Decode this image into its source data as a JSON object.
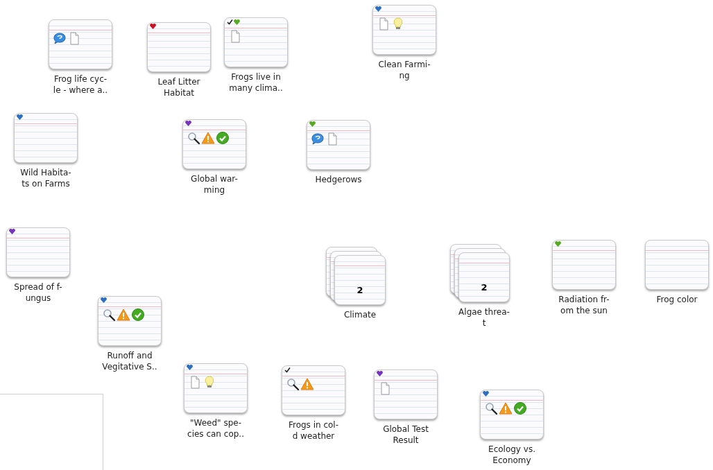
{
  "cards": [
    {
      "kind": "card",
      "label_lines": [
        "Frog life cyc-",
        "le - where a.."
      ],
      "checked": false,
      "icons": [
        {
          "kind": "comment"
        },
        {
          "kind": "document"
        }
      ]
    },
    {
      "kind": "card",
      "label_lines": [
        "Leaf Litter",
        "Habitat"
      ],
      "checked": false,
      "color": "#cc1122"
    },
    {
      "kind": "card",
      "label_lines": [
        "Frogs live in",
        "many clima.."
      ],
      "checked": true,
      "color": "#55aa22",
      "icons": [
        {
          "kind": "document"
        }
      ]
    },
    {
      "kind": "card",
      "label_lines": [
        "Clean Farmi-",
        "ng"
      ],
      "checked": false,
      "color": "#2a6fc0",
      "icons": [
        {
          "kind": "document"
        },
        {
          "kind": "bulb"
        }
      ]
    },
    {
      "kind": "card",
      "label_lines": [
        "Wild Habita-",
        "ts on Farms"
      ],
      "checked": false,
      "color": "#2a6fc0"
    },
    {
      "kind": "card",
      "label_lines": [
        "Global war-",
        "ming"
      ],
      "checked": false,
      "color": "#7733bb",
      "icons": [
        {
          "kind": "search"
        },
        {
          "kind": "warning"
        },
        {
          "kind": "ok"
        }
      ]
    },
    {
      "kind": "card",
      "label_lines": [
        "Hedgerows"
      ],
      "checked": false,
      "color": "#55aa22",
      "icons": [
        {
          "kind": "comment"
        },
        {
          "kind": "document"
        }
      ]
    },
    {
      "kind": "card",
      "label_lines": [
        "Spread of f-",
        "ungus"
      ],
      "checked": false,
      "color": "#7733bb"
    },
    {
      "kind": "stack",
      "label_lines": [
        "Climate"
      ],
      "count": "2"
    },
    {
      "kind": "stack",
      "label_lines": [
        "Algae threa-",
        "t"
      ],
      "count": "2"
    },
    {
      "kind": "card",
      "label_lines": [
        "Radiation fr-",
        "om the sun"
      ],
      "checked": false,
      "color": "#55aa22"
    },
    {
      "kind": "card",
      "label_lines": [
        "Frog color"
      ],
      "checked": false
    },
    {
      "kind": "card",
      "label_lines": [
        "Runoff and",
        "Vegitative S.."
      ],
      "checked": false,
      "color": "#2a6fc0",
      "icons": [
        {
          "kind": "search"
        },
        {
          "kind": "warning"
        },
        {
          "kind": "ok"
        }
      ]
    },
    {
      "kind": "card",
      "label_lines": [
        "\"Weed\" spe-",
        "cies can cop.."
      ],
      "checked": false,
      "color": "#2a6fc0",
      "icons": [
        {
          "kind": "document"
        },
        {
          "kind": "bulb"
        }
      ]
    },
    {
      "kind": "card",
      "label_lines": [
        "Frogs in col-",
        "d weather"
      ],
      "checked": true,
      "icons": [
        {
          "kind": "search"
        },
        {
          "kind": "warning"
        }
      ]
    },
    {
      "kind": "card",
      "label_lines": [
        "Global Test",
        "Result"
      ],
      "checked": false,
      "color": "#7733bb",
      "icons": [
        {
          "kind": "document"
        }
      ]
    },
    {
      "kind": "card",
      "label_lines": [
        "Ecology vs.",
        "Economy"
      ],
      "checked": false,
      "color": "#2a6fc0",
      "icons": [
        {
          "kind": "search"
        },
        {
          "kind": "warning"
        },
        {
          "kind": "ok"
        }
      ]
    }
  ]
}
